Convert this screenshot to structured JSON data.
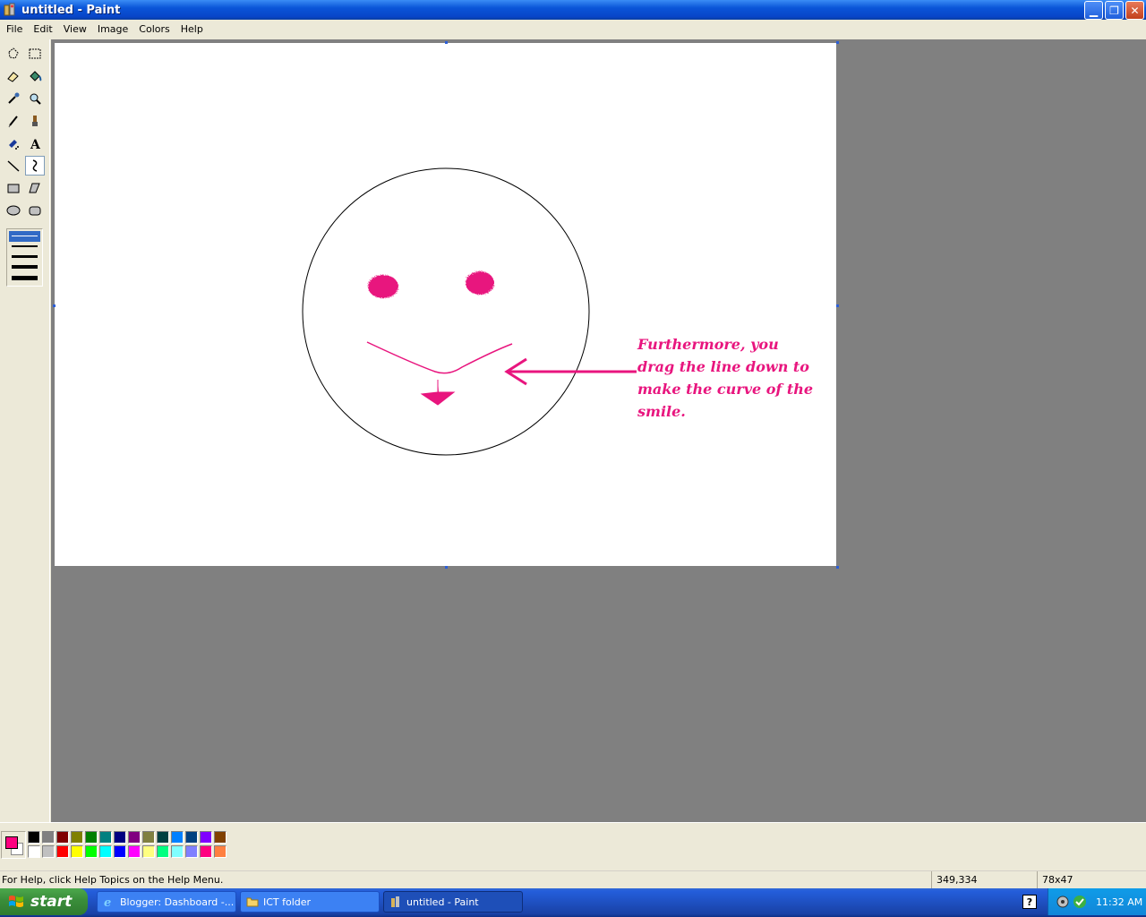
{
  "window": {
    "title": "untitled - Paint",
    "app_icon": "paint-icon",
    "buttons": [
      "minimize-icon",
      "restore-icon",
      "close-icon"
    ]
  },
  "menu": [
    "File",
    "Edit",
    "View",
    "Image",
    "Colors",
    "Help"
  ],
  "toolbox": {
    "tools": [
      {
        "name": "free-form-select",
        "icon": "free-select-icon"
      },
      {
        "name": "select",
        "icon": "rect-select-icon"
      },
      {
        "name": "eraser",
        "icon": "eraser-icon"
      },
      {
        "name": "fill-with-color",
        "icon": "fill-bucket-icon"
      },
      {
        "name": "pick-color",
        "icon": "eyedropper-icon"
      },
      {
        "name": "magnifier",
        "icon": "magnifier-icon"
      },
      {
        "name": "pencil",
        "icon": "pencil-icon"
      },
      {
        "name": "brush",
        "icon": "brush-icon"
      },
      {
        "name": "airbrush",
        "icon": "airbrush-icon"
      },
      {
        "name": "text",
        "icon": "text-icon"
      },
      {
        "name": "line",
        "icon": "line-icon"
      },
      {
        "name": "curve",
        "icon": "curve-icon",
        "selected": true
      },
      {
        "name": "rectangle",
        "icon": "rectangle-icon"
      },
      {
        "name": "polygon",
        "icon": "polygon-icon"
      },
      {
        "name": "ellipse",
        "icon": "ellipse-icon"
      },
      {
        "name": "rounded-rectangle",
        "icon": "rounded-rect-icon"
      }
    ],
    "line_widths_count": 5,
    "selected_line_width_index": 0
  },
  "canvas": {
    "annotation_lines": [
      "Furthermore, you",
      "drag the line down to",
      "make the curve of the",
      "smile."
    ],
    "annotation_color": "#e8157e",
    "outline_color": "#000000"
  },
  "palette": {
    "foreground": "#ff0080",
    "background": "#ffffff",
    "top_row": [
      "#000000",
      "#808080",
      "#800000",
      "#808000",
      "#008000",
      "#008080",
      "#000080",
      "#800080",
      "#808040",
      "#004040",
      "#0080ff",
      "#004080",
      "#8000ff",
      "#804000"
    ],
    "bottom_row": [
      "#ffffff",
      "#c0c0c0",
      "#ff0000",
      "#ffff00",
      "#00ff00",
      "#00ffff",
      "#0000ff",
      "#ff00ff",
      "#ffff80",
      "#00ff80",
      "#80ffff",
      "#8080ff",
      "#ff0080",
      "#ff8040"
    ]
  },
  "status": {
    "help_text": "For Help, click Help Topics on the Help Menu.",
    "cursor_position": "349,334",
    "selection_size": "78x47"
  },
  "taskbar": {
    "start_label": "start",
    "tasks": [
      {
        "label": "Blogger: Dashboard -...",
        "icon": "ie-icon"
      },
      {
        "label": "ICT folder",
        "icon": "folder-icon"
      },
      {
        "label": "untitled - Paint",
        "icon": "paint-icon",
        "active": true
      }
    ],
    "clock": "11:32 AM",
    "tray_icons": [
      "help-tray-icon",
      "network-tray-icon",
      "security-shield-icon"
    ]
  }
}
